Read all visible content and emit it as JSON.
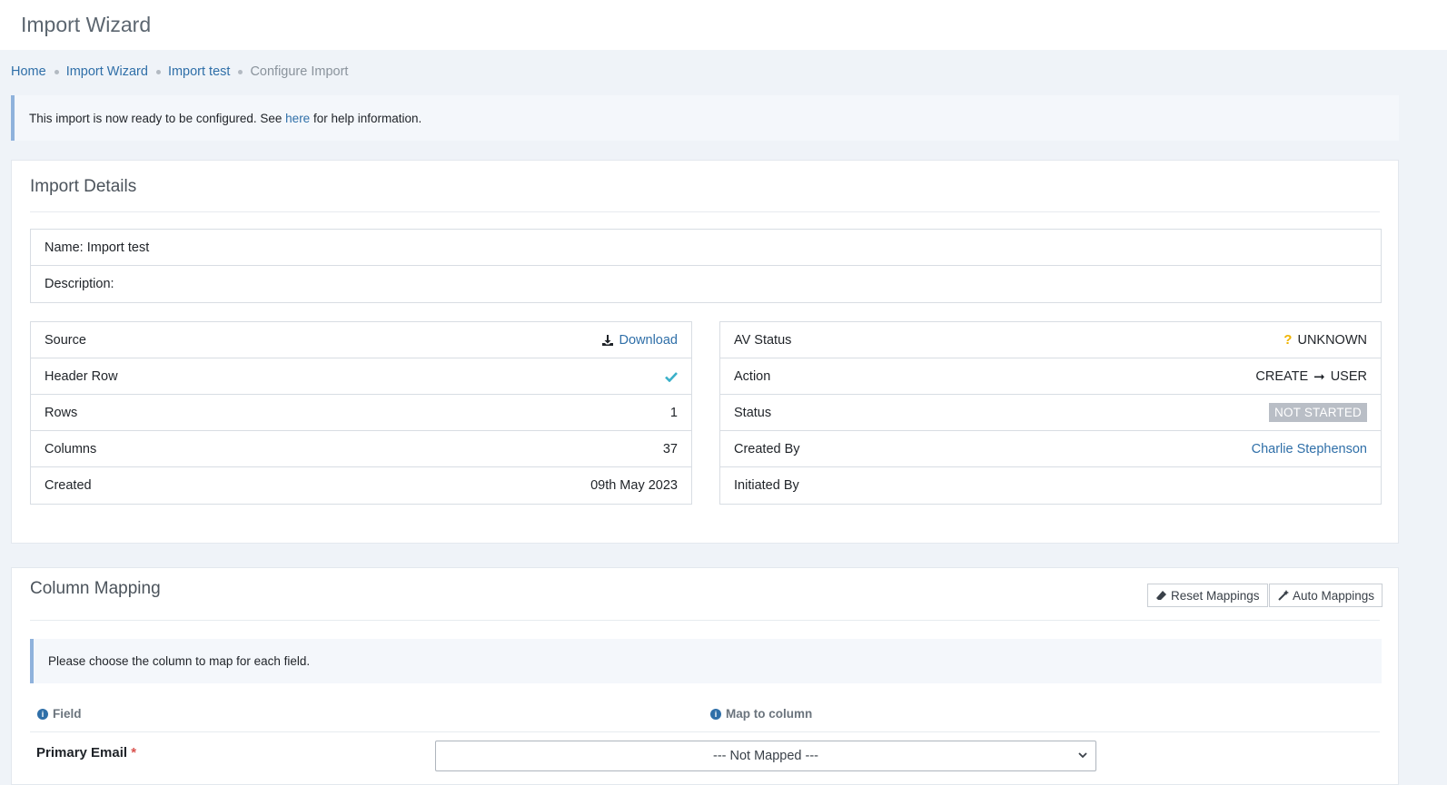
{
  "header": {
    "title": "Import Wizard"
  },
  "breadcrumb": [
    {
      "label": "Home"
    },
    {
      "label": "Import Wizard"
    },
    {
      "label": "Import test"
    },
    {
      "label": "Configure Import"
    }
  ],
  "alert": {
    "text_before": "This import is now ready to be configured. See",
    "link": "here",
    "text_after": "for help information."
  },
  "import_details": {
    "title": "Import Details",
    "name_row": "Name: Import test",
    "description_row": "Description:",
    "left": {
      "source_label": "Source",
      "source_value": "Download",
      "header_row_label": "Header Row",
      "rows_label": "Rows",
      "rows_value": "1",
      "columns_label": "Columns",
      "columns_value": "37",
      "created_label": "Created",
      "created_value": "09th May 2023"
    },
    "right": {
      "av_status_label": "AV Status",
      "av_status_value": "UNKNOWN",
      "action_label": "Action",
      "action_from": "CREATE",
      "action_to": "USER",
      "status_label": "Status",
      "status_value": "NOT STARTED",
      "created_by_label": "Created By",
      "created_by_value": "Charlie Stephenson",
      "initiated_by_label": "Initiated By"
    }
  },
  "column_mapping": {
    "title": "Column Mapping",
    "reset_label": "Reset Mappings",
    "auto_label": "Auto Mappings",
    "help_text": "Please choose the column to map for each field.",
    "field_header": "Field",
    "map_header": "Map to column",
    "rows": [
      {
        "field": "Primary Email",
        "required_mark": "*",
        "selected": "--- Not Mapped ---"
      }
    ]
  },
  "colors": {
    "accent": "#2f6fa8",
    "check": "#3ab0c9",
    "warning": "#f0b400",
    "badge": "#b9bec6"
  }
}
